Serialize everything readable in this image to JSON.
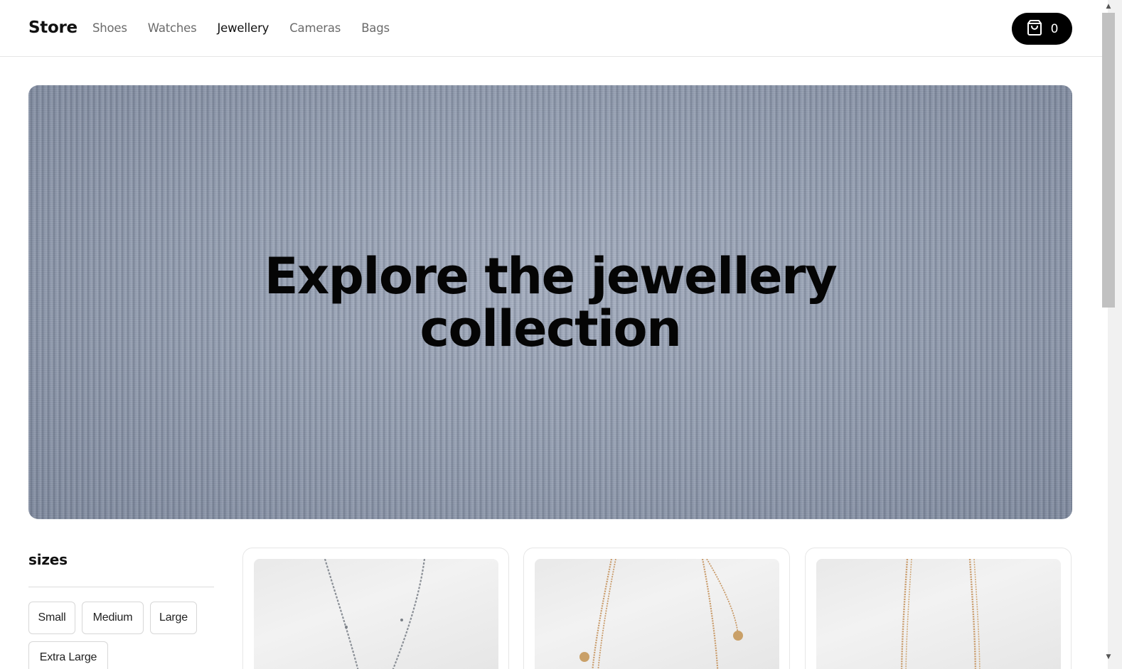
{
  "header": {
    "logo": "Store",
    "nav": [
      {
        "label": "Shoes",
        "active": false
      },
      {
        "label": "Watches",
        "active": false
      },
      {
        "label": "Jewellery",
        "active": true
      },
      {
        "label": "Cameras",
        "active": false
      },
      {
        "label": "Bags",
        "active": false
      }
    ],
    "cart": {
      "icon": "shopping-bag-icon",
      "count": "0"
    }
  },
  "hero": {
    "title_line1": "Explore the jewellery",
    "title_line2": "collection"
  },
  "filters": {
    "title": "sizes",
    "sizes": [
      "Small",
      "Medium",
      "Large",
      "Extra Large"
    ]
  },
  "products": [
    {
      "image": "silver-chain-necklace"
    },
    {
      "image": "gold-coin-layered-necklace"
    },
    {
      "image": "gold-chain-necklace"
    }
  ],
  "colors": {
    "accent": "#000000",
    "hero_bg": "#8e9aaf",
    "nav_inactive": "#6b6b6b"
  }
}
